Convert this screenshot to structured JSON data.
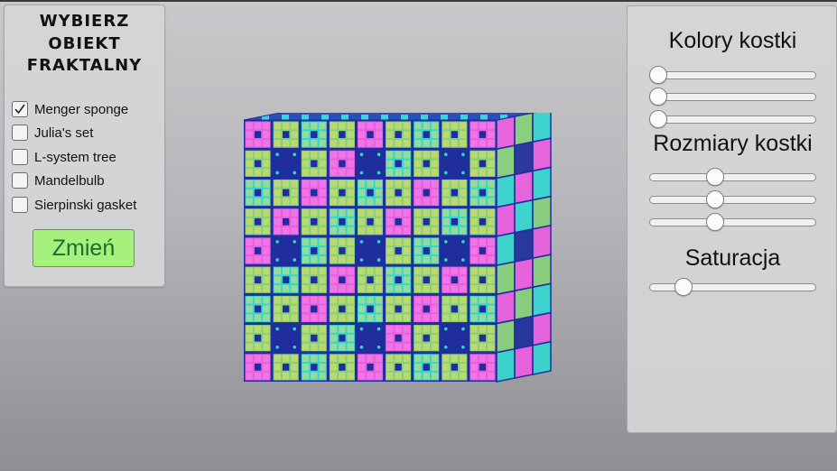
{
  "left_panel": {
    "title": "WYBIERZ\nOBIEKT\nFRAKTALNY",
    "options": [
      {
        "label": "Menger sponge",
        "checked": true
      },
      {
        "label": "Julia's set",
        "checked": false
      },
      {
        "label": "L-system tree",
        "checked": false
      },
      {
        "label": "Mandelbulb",
        "checked": false
      },
      {
        "label": "Sierpinski gasket",
        "checked": false
      }
    ],
    "change_button": "Zmień"
  },
  "right_panel": {
    "cube_colors_title": "Kolory kostki",
    "cube_colors_sliders": [
      0.0,
      0.0,
      0.0
    ],
    "cube_size_title": "Rozmiary kostki",
    "cube_size_sliders": [
      0.38,
      0.38,
      0.38
    ],
    "saturation_title": "Saturacja",
    "saturation_slider": 0.17
  },
  "viewport": {
    "object": "Menger sponge",
    "colors": {
      "cyan": "#35d6d0",
      "green": "#86d07a",
      "navy": "#1f2e9c",
      "magenta": "#ea5ddf",
      "yellow": "#e8e06a"
    }
  }
}
